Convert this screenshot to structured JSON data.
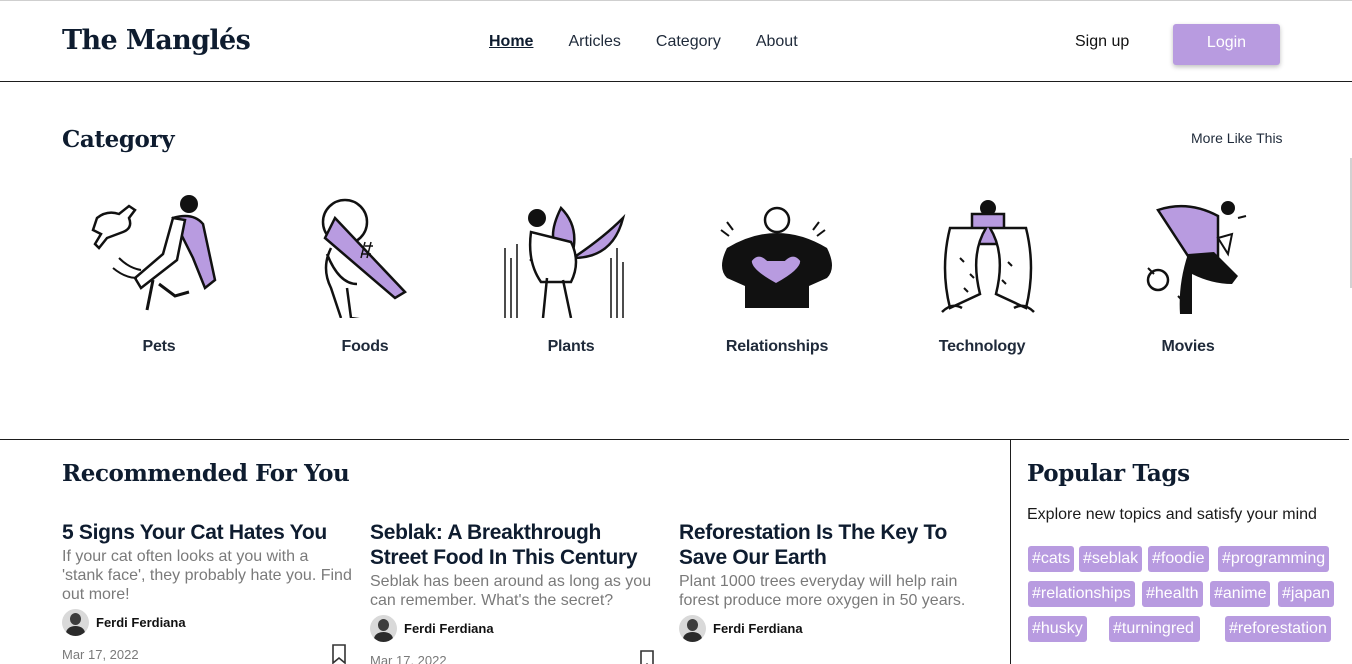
{
  "header": {
    "brand": "The Manglés",
    "nav": [
      "Home",
      "Articles",
      "Category",
      "About"
    ],
    "signup": "Sign up",
    "login": "Login"
  },
  "category": {
    "title": "Category",
    "more": "More Like This",
    "items": [
      "Pets",
      "Foods",
      "Plants",
      "Relationships",
      "Technology",
      "Movies"
    ]
  },
  "recommended": {
    "title": "Recommended For You",
    "articles": [
      {
        "title": "5 Signs Your Cat Hates You",
        "excerpt": "If your cat often looks at you with a 'stank face', they probably hate you. Find out more!",
        "author": "Ferdi Ferdiana",
        "date": "Mar 17, 2022"
      },
      {
        "title": "Seblak: A Breakthrough Street Food In This Century",
        "excerpt": "Seblak has been around as long as you can remember. What's the secret?",
        "author": "Ferdi Ferdiana",
        "date": "Mar 17, 2022"
      },
      {
        "title": "Reforestation Is The Key To Save Our Earth",
        "excerpt": "Plant 1000 trees everyday will help rain forest produce more oxygen in 50 years.",
        "author": "Ferdi Ferdiana",
        "date": ""
      }
    ]
  },
  "popular_tags": {
    "title": "Popular Tags",
    "subtitle": "Explore new topics and satisfy your mind",
    "tags": [
      "#cats",
      "#seblak",
      "#foodie",
      "#programming",
      "#relationships",
      "#health",
      "#anime",
      "#japan",
      "#husky",
      "#turningred",
      "#reforestation"
    ]
  },
  "colors": {
    "accent": "#b89be0",
    "text": "#0e1c2f"
  },
  "icons": [
    "bookmark-icon",
    "avatar"
  ]
}
